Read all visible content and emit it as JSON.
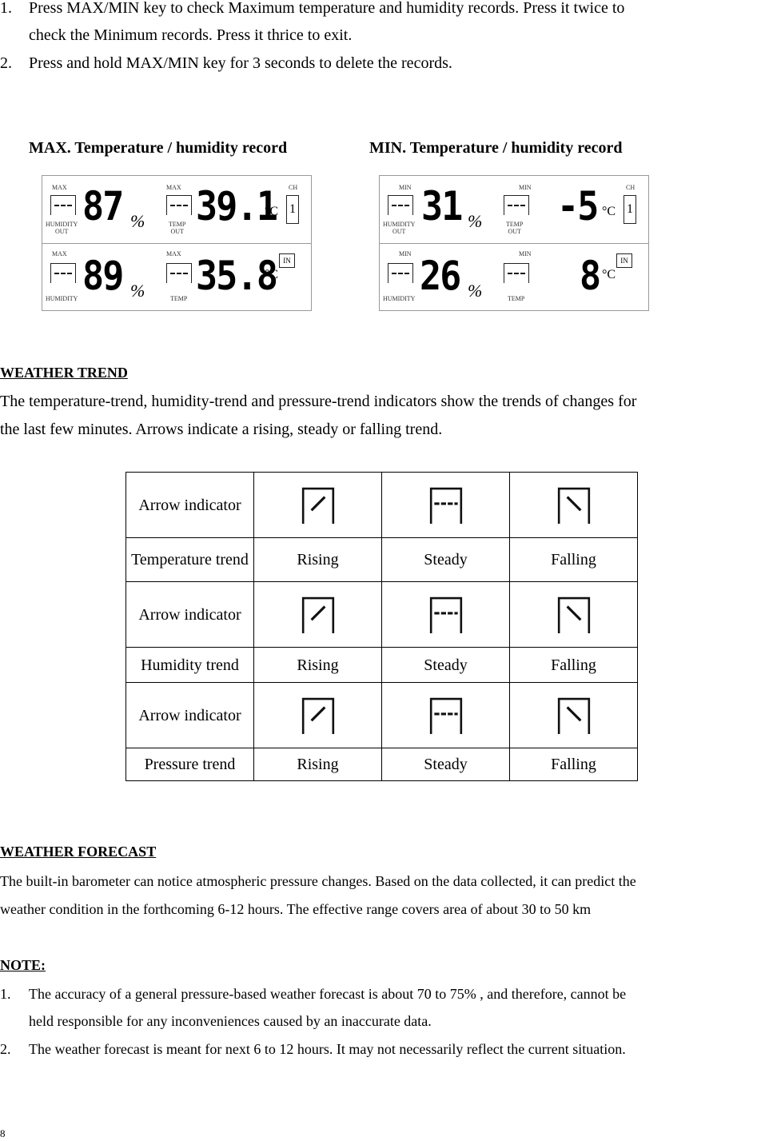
{
  "intro_list": [
    {
      "num": "1.",
      "lines": [
        "Press MAX/MIN key to check Maximum temperature and humidity records. Press it twice to",
        "check the Minimum records. Press it thrice to exit."
      ]
    },
    {
      "num": "2.",
      "lines": [
        "Press and hold MAX/MIN key for 3 seconds to delete the records."
      ]
    }
  ],
  "captions": {
    "max": "MAX. Temperature / humidity record",
    "min": "MIN. Temperature / humidity record"
  },
  "lcd_max": {
    "tag": "MAX",
    "hum_out": "87",
    "temp_out": "39.1",
    "hum_in": "89",
    "temp_in": "35.8",
    "channel": "1"
  },
  "lcd_min": {
    "tag": "MIN",
    "hum_out": "31",
    "temp_out": "-5",
    "hum_in": "26",
    "temp_in": "8",
    "channel": "1"
  },
  "lcd_labels": {
    "humidity_out": [
      "HUMIDITY",
      "OUT"
    ],
    "temp_out": [
      "TEMP",
      "OUT"
    ],
    "humidity": "HUMIDITY",
    "temp": "TEMP",
    "percent": "%",
    "celsius": "°C",
    "ch": "CH",
    "in": "IN"
  },
  "weather_trend": {
    "heading": "WEATHER TREND",
    "lines": [
      "The temperature-trend, humidity-trend and pressure-trend indicators show the trends of changes for",
      "the last few minutes. Arrows indicate a rising, steady or falling trend."
    ]
  },
  "trend_table": {
    "rows": [
      {
        "indicator_label": "Arrow indicator",
        "trend_label": "Temperature trend",
        "values": [
          "Rising",
          "Steady",
          "Falling"
        ]
      },
      {
        "indicator_label": "Arrow indicator",
        "trend_label": "Humidity trend",
        "values": [
          "Rising",
          "Steady",
          "Falling"
        ]
      },
      {
        "indicator_label": "Arrow indicator",
        "trend_label": "Pressure trend",
        "values": [
          "Rising",
          "Steady",
          "Falling"
        ]
      }
    ],
    "icons": [
      "arrow-rising-icon",
      "arrow-steady-icon",
      "arrow-falling-icon"
    ]
  },
  "weather_forecast": {
    "heading": "WEATHER FORECAST",
    "lines": [
      "The built-in barometer can notice atmospheric pressure changes. Based on the data collected, it can predict the",
      "weather condition in the forthcoming 6-12 hours. The effective range covers area of about 30 to 50 km"
    ]
  },
  "note": {
    "heading": "NOTE:",
    "items": [
      {
        "num": "1.",
        "lines": [
          "The accuracy of a general pressure-based weather forecast is about 70 to 75% , and therefore, cannot be",
          "held responsible for any inconveniences caused by an inaccurate data."
        ]
      },
      {
        "num": "2.",
        "lines": [
          "The weather forecast is meant for next 6 to 12 hours. It may not necessarily reflect the current situation."
        ]
      }
    ]
  },
  "page_number": "8"
}
